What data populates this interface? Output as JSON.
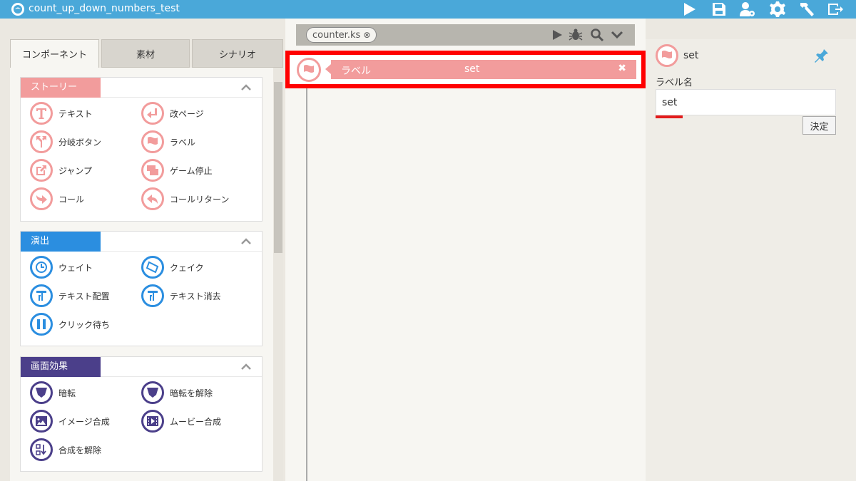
{
  "app": {
    "title": "count_up_down_numbers_test"
  },
  "toolbar": {
    "icons": [
      "play-icon",
      "save-icon",
      "user-settings-icon",
      "gear-icon",
      "hammer-icon",
      "exit-icon"
    ]
  },
  "left": {
    "tabs": [
      {
        "label": "コンポーネント",
        "active": true
      },
      {
        "label": "素材",
        "active": false
      },
      {
        "label": "シナリオ",
        "active": false
      }
    ],
    "sections": [
      {
        "title": "ストーリー",
        "color": "#f29c9c",
        "items": [
          {
            "label": "テキスト",
            "icon": "text-t-icon"
          },
          {
            "label": "改ページ",
            "icon": "return-arrow-icon"
          },
          {
            "label": "分岐ボタン",
            "icon": "branch-icon"
          },
          {
            "label": "ラベル",
            "icon": "flag-icon"
          },
          {
            "label": "ジャンプ",
            "icon": "jump-icon"
          },
          {
            "label": "ゲーム停止",
            "icon": "window-stop-icon"
          },
          {
            "label": "コール",
            "icon": "call-arrow-icon"
          },
          {
            "label": "コールリターン",
            "icon": "call-return-icon"
          }
        ]
      },
      {
        "title": "演出",
        "color": "#2b8ee0",
        "items": [
          {
            "label": "ウェイト",
            "icon": "clock-icon"
          },
          {
            "label": "クェイク",
            "icon": "quake-icon"
          },
          {
            "label": "テキスト配置",
            "icon": "text-place-icon"
          },
          {
            "label": "テキスト消去",
            "icon": "text-erase-icon"
          },
          {
            "label": "クリック待ち",
            "icon": "pause-icon"
          }
        ]
      },
      {
        "title": "画面効果",
        "color": "#4b3f8a",
        "items": [
          {
            "label": "暗転",
            "icon": "shield-icon"
          },
          {
            "label": "暗転を解除",
            "icon": "shield-release-icon"
          },
          {
            "label": "イメージ合成",
            "icon": "image-icon"
          },
          {
            "label": "ムービー合成",
            "icon": "movie-icon"
          },
          {
            "label": "合成を解除",
            "icon": "composite-release-icon"
          }
        ]
      }
    ]
  },
  "center": {
    "file_tab": "counter.ks",
    "file_icons": [
      "play-icon",
      "bug-icon",
      "search-icon",
      "chevron-down-icon"
    ],
    "rows": [
      {
        "type": "ラベル",
        "value": "set",
        "selected": true
      }
    ]
  },
  "right": {
    "title": "set",
    "field_label": "ラベル名",
    "field_value": "set",
    "ok_label": "決定"
  }
}
